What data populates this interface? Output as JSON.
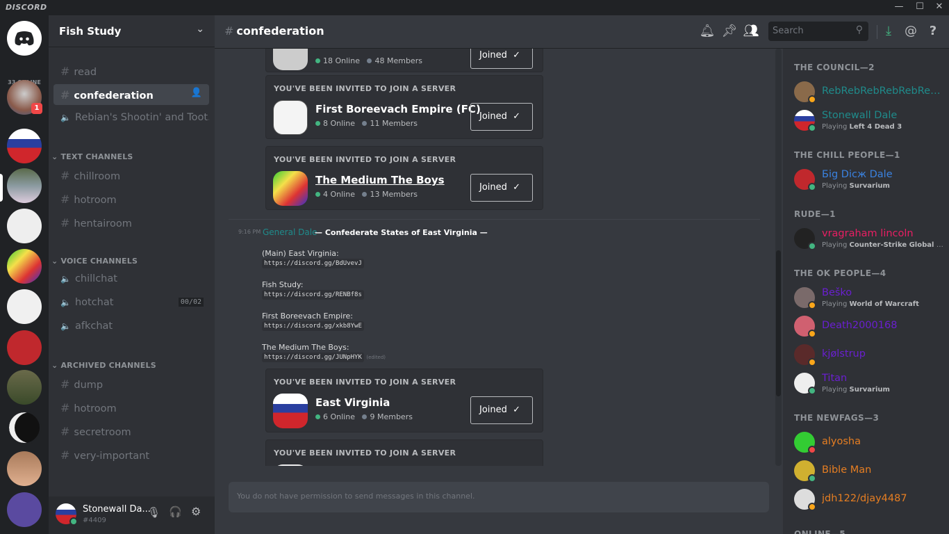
{
  "app": {
    "logo": "DISCORD",
    "win_controls": [
      "—",
      "☐",
      "✕"
    ]
  },
  "servers": {
    "online_count": "33 ONLINE",
    "mention_badge": "1"
  },
  "guild": {
    "name": "Fish Study"
  },
  "channels": {
    "top": [
      {
        "name": "read"
      },
      {
        "name": "confederation",
        "selected": true
      },
      {
        "name": "Rebian's Shootin' and Toot...",
        "type": "locked-voice"
      }
    ],
    "categories": [
      {
        "label": "TEXT CHANNELS",
        "items": [
          "chillroom",
          "hotroom",
          "hentairoom"
        ]
      },
      {
        "label": "VOICE CHANNELS",
        "items": [
          "chillchat",
          "hotchat",
          "afkchat"
        ],
        "hotchat_limit": "00/02"
      },
      {
        "label": "ARCHIVED CHANNELS",
        "items": [
          "dump",
          "hotroom",
          "secretroom",
          "very-important"
        ]
      }
    ]
  },
  "user": {
    "name": "Stonewall Da...",
    "tag": "#4409"
  },
  "header": {
    "channel": "confederation",
    "search_placeholder": "Search"
  },
  "invites": [
    {
      "title": "",
      "name": "",
      "online": "18 Online",
      "members": "48 Members",
      "button": "Joined"
    },
    {
      "title": "YOU'VE BEEN INVITED TO JOIN A SERVER",
      "name": "First Boreevach Empire (FC)",
      "online": "8 Online",
      "members": "11 Members",
      "button": "Joined"
    },
    {
      "title": "YOU'VE BEEN INVITED TO JOIN A SERVER",
      "name": "The Medium The Boys",
      "online": "4 Online",
      "members": "13 Members",
      "button": "Joined"
    },
    {
      "title": "YOU'VE BEEN INVITED TO JOIN A SERVER",
      "name": "East Virginia",
      "online": "6 Online",
      "members": "9 Members",
      "button": "Joined"
    },
    {
      "title": "YOU'VE BEEN INVITED TO JOIN A SERVER"
    }
  ],
  "message": {
    "time": "9:16 PM",
    "author": "General Dale",
    "heading": "— Confederate States of East Virginia —",
    "lines": [
      {
        "label": "(Main) East Virginia:",
        "link": "https://discord.gg/BdUvevJ"
      },
      {
        "label": "Fish Study:",
        "link": "https://discord.gg/RENBf8s"
      },
      {
        "label": "First Boreevach Empire:",
        "link": "https://discord.gg/xkb8YwE"
      },
      {
        "label": "The Medium The Boys:",
        "link": "https://discord.gg/JUNpHYK"
      }
    ],
    "edited": "(edited)"
  },
  "input": {
    "placeholder": "You do not have permission to send messages in this channel."
  },
  "members": {
    "groups": [
      {
        "label": "THE COUNCIL—2",
        "members": [
          {
            "name": "RebRebRebRebRebRebR...",
            "color": "#1f8b8b",
            "status": "idle",
            "game": ""
          },
          {
            "name": "Stonewall Dale",
            "color": "#1f8b8b",
            "status": "online",
            "game": "Left 4 Dead 3"
          }
        ]
      },
      {
        "label": "THE CHILL PEOPLE—1",
        "members": [
          {
            "name": "Біg Dісж Dale",
            "color": "#3a82e0",
            "status": "online",
            "game": "Survarium"
          }
        ]
      },
      {
        "label": "RUDE—1",
        "members": [
          {
            "name": "vragraham lincoln",
            "color": "#e91e63",
            "status": "online",
            "game": "Counter-Strike Global Offe..."
          }
        ]
      },
      {
        "label": "THE OK PEOPLE—4",
        "members": [
          {
            "name": "Beško",
            "color": "#6a1fd0",
            "status": "idle",
            "game": "World of Warcraft"
          },
          {
            "name": "Death2000168",
            "color": "#6a1fd0",
            "status": "idle",
            "game": ""
          },
          {
            "name": "kjølstrup",
            "color": "#6a1fd0",
            "status": "idle",
            "game": ""
          },
          {
            "name": "Titan",
            "color": "#6a1fd0",
            "status": "online",
            "game": "Survarium"
          }
        ]
      },
      {
        "label": "THE NEWFAGS—3",
        "members": [
          {
            "name": "alyosha",
            "color": "#e67e22",
            "status": "dnd",
            "game": ""
          },
          {
            "name": "Bible Man",
            "color": "#e67e22",
            "status": "online",
            "game": ""
          },
          {
            "name": "jdh122/djay4487",
            "color": "#e67e22",
            "status": "idle",
            "game": ""
          }
        ]
      },
      {
        "label": "ONLINE—5",
        "members": []
      }
    ],
    "playing_prefix": "Playing"
  },
  "colors": {
    "online": "#43b581",
    "idle": "#faa61a",
    "dnd": "#f04747",
    "accent": "#7289da",
    "download": "#43b581"
  }
}
